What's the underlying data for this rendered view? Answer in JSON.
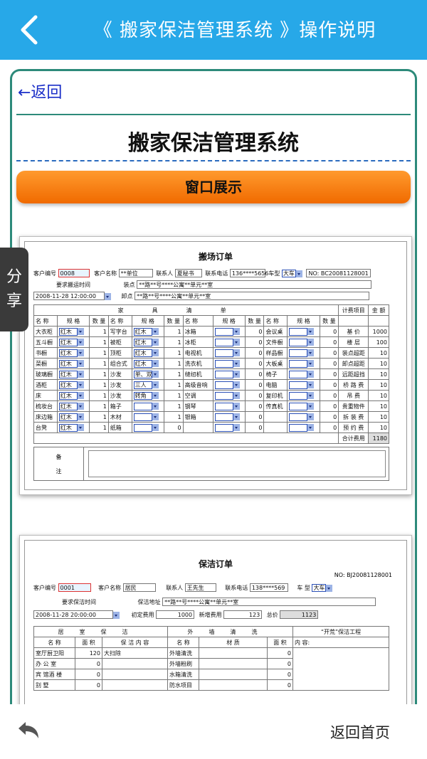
{
  "header": {
    "title": "《 搬家保洁管理系统 》操作说明"
  },
  "content": {
    "back_link": "←返回",
    "app_title": "搬家保洁管理系统",
    "section_label": "窗口展示"
  },
  "share_tab": {
    "label_1": "分",
    "label_2": "享"
  },
  "moving_form": {
    "caption": "搬场订单",
    "customer_no_label": "客户编号",
    "customer_no": "0008",
    "customer_name_label": "客户名称",
    "customer_name": "**单位",
    "contact_label": "联系人",
    "contact": "夏秘书",
    "phone_label": "联系电话",
    "phone": "136****5656",
    "vehicle_label": "车型",
    "vehicle": "大车",
    "order_no": "NO: BC20081128001",
    "time_label": "要求搬运时间",
    "time": "2008-11-28 12:00:00",
    "load_label": "装点",
    "load_addr": "**路**号****公寓**单元**室",
    "unload_label": "卸点",
    "unload_addr": "**路**号****公寓**单元**室",
    "furniture_header": [
      "家",
      "具",
      "清",
      "单"
    ],
    "col_headers": {
      "name": "名 称",
      "spec": "规 格",
      "qty": "数 量"
    },
    "charge_header": "计费项目",
    "amount_header": "金 额",
    "rows": [
      [
        "大衣柜",
        "红木",
        "1",
        "写字台",
        "红木",
        "1",
        "冰箱",
        "",
        "0",
        "会议桌",
        "",
        "0",
        "基 价",
        "1000"
      ],
      [
        "五斗橱",
        "红木",
        "1",
        "被柜",
        "红木",
        "1",
        "冰柜",
        "",
        "0",
        "文件橱",
        "",
        "0",
        "楼 层",
        "100"
      ],
      [
        "书橱",
        "红木",
        "1",
        "顶柜",
        "红木",
        "1",
        "电视机",
        "",
        "0",
        "样品橱",
        "",
        "0",
        "装点超距",
        "10"
      ],
      [
        "菜橱",
        "红木",
        "1",
        "组合式",
        "红木",
        "1",
        "洗衣机",
        "",
        "0",
        "大板桌",
        "",
        "0",
        "卸点超距",
        "10"
      ],
      [
        "玻璃橱",
        "红木",
        "1",
        "沙发",
        "单、双",
        "1",
        "缝纫机",
        "",
        "0",
        "椅子",
        "",
        "0",
        "远距超挡",
        "10"
      ],
      [
        "酒柜",
        "红木",
        "1",
        "沙发",
        "三人",
        "1",
        "高级音响",
        "",
        "0",
        "电脑",
        "",
        "0",
        "桥 路 费",
        "10"
      ],
      [
        "床",
        "红木",
        "1",
        "沙发",
        "转角",
        "1",
        "空调",
        "",
        "0",
        "复印机",
        "",
        "0",
        "吊 费",
        "10"
      ],
      [
        "梳妆台",
        "红木",
        "1",
        "箱子",
        "",
        "1",
        "钢琴",
        "",
        "0",
        "传真机",
        "",
        "0",
        "贵重物件",
        "10"
      ],
      [
        "床边箱",
        "红木",
        "1",
        "木材",
        "",
        "1",
        "银箱",
        "",
        "0",
        "",
        "",
        "0",
        "拆 装 费",
        "10"
      ],
      [
        "台凳",
        "红木",
        "1",
        "纸箱",
        "",
        "0",
        "",
        "",
        "0",
        "",
        "",
        "0",
        "预 约 费",
        "10"
      ]
    ],
    "total_label": "合计费用",
    "total": "1180",
    "remark_label_1": "备",
    "remark_label_2": "注"
  },
  "cleaning_form": {
    "caption": "保洁订单",
    "order_no": "NO: BJ20081128001",
    "customer_no_label": "客户编号",
    "customer_no": "0001",
    "customer_name_label": "客户名称",
    "customer_name": "居民",
    "contact_label": "联系人",
    "contact": "王先生",
    "phone_label": "联系电话",
    "phone": "138****569",
    "vehicle_label": "车 型",
    "vehicle": "大车",
    "time_label": "要求保洁时间",
    "time": "2008-11-28 20:00:00",
    "address_label": "保洁地址",
    "address": "**路**号****公寓**单元**室",
    "initial_fee_label": "初定费用",
    "initial_fee": "1000",
    "added_fee_label": "新增费用",
    "added_fee": "123",
    "total_label": "总价",
    "total": "1123",
    "sec_indoor": [
      "居",
      "室",
      "保",
      "洁"
    ],
    "sec_outdoor": [
      "外",
      "墙",
      "清",
      "洗"
    ],
    "sec_special": "“开荒”保洁工程",
    "h_name": "名 称",
    "h_area": "面 积",
    "h_content": "保 洁 内 容",
    "h_material": "材 质",
    "h_content2": "内 容:",
    "rows": [
      [
        "室厅厨卫阳",
        "120",
        "大扫除",
        "外墙清洗",
        "",
        "0"
      ],
      [
        "办 公 室",
        "0",
        "",
        "外墙粉刷",
        "",
        "0"
      ],
      [
        "宾 馆酒 楼",
        "0",
        "",
        "水箱清洗",
        "",
        "0"
      ],
      [
        "别 墅",
        "0",
        "",
        "防水项目",
        "",
        "0"
      ]
    ]
  },
  "footer": {
    "home_label": "返回首页"
  }
}
